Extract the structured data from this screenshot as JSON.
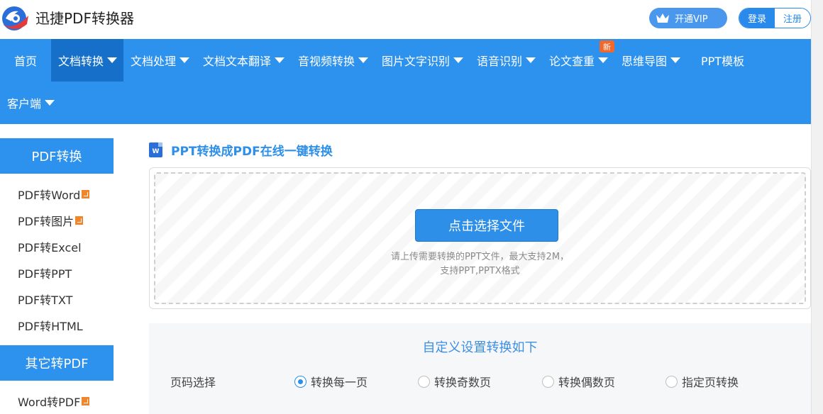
{
  "header": {
    "brand": "迅捷PDF转换器",
    "vip_label": "开通VIP",
    "login_label": "登录",
    "register_label": "注册"
  },
  "nav": {
    "items": [
      {
        "label": "首页"
      },
      {
        "label": "文档转换"
      },
      {
        "label": "文档处理"
      },
      {
        "label": "文档文本翻译"
      },
      {
        "label": "音视频转换"
      },
      {
        "label": "图片文字识别"
      },
      {
        "label": "语音识别"
      },
      {
        "label": "论文查重"
      },
      {
        "label": "思维导图"
      },
      {
        "label": "PPT模板"
      },
      {
        "label": "客户端"
      }
    ],
    "new_badge": "新"
  },
  "sidebar": {
    "section1_title": "PDF转换",
    "section1_items": [
      "PDF转Word",
      "PDF转图片",
      "PDF转Excel",
      "PDF转PPT",
      "PDF转TXT",
      "PDF转HTML"
    ],
    "section2_title": "其它转PDF",
    "section2_items": [
      "Word转PDF"
    ]
  },
  "main": {
    "title": "PPT转换成PDF在线一键转换",
    "word_icon_letter": "W",
    "choose_button": "点击选择文件",
    "hint_line1": "请上传需要转换的PPT文件，最大支持2M，",
    "hint_line2": "支持PPT,PPTX格式"
  },
  "settings": {
    "title": "自定义设置转换如下",
    "page_select_label": "页码选择",
    "options": [
      "转换每一页",
      "转换奇数页",
      "转换偶数页",
      "指定页转换"
    ],
    "selected_index": 0
  },
  "colors": {
    "nav_bg": "#2d91ee",
    "nav_active": "#1670c9",
    "accent": "#2d8fe8",
    "badge": "#f2682a"
  }
}
